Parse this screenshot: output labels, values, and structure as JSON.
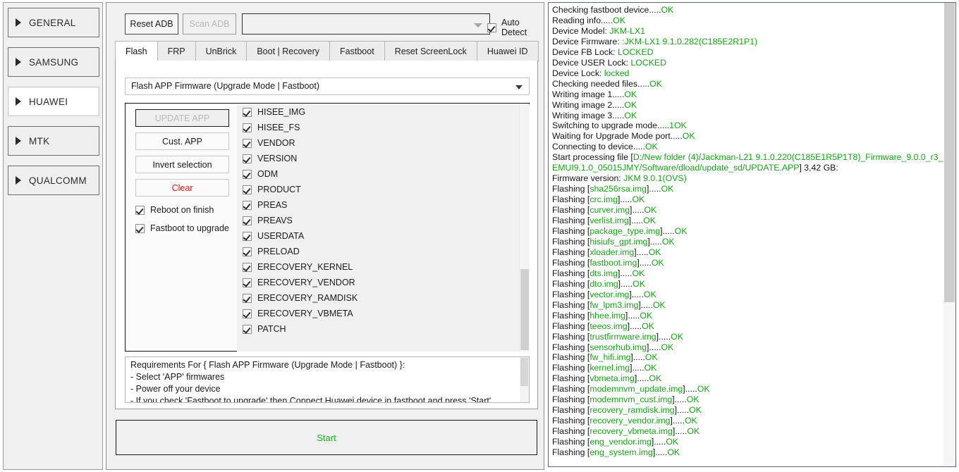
{
  "sidebar": {
    "items": [
      {
        "label": "GENERAL",
        "active": false
      },
      {
        "label": "SAMSUNG",
        "active": false
      },
      {
        "label": "HUAWEI",
        "active": true
      },
      {
        "label": "MTK",
        "active": false
      },
      {
        "label": "QUALCOMM",
        "active": false
      }
    ]
  },
  "toolbar": {
    "reset_adb_label": "Reset ADB",
    "scan_adb_label": "Scan ADB",
    "device_combo_value": "",
    "device_combo_placeholder": "",
    "auto_detect_label": "Auto Detect",
    "auto_detect_checked": true
  },
  "tabs": [
    {
      "label": "Flash",
      "active": true
    },
    {
      "label": "FRP",
      "active": false
    },
    {
      "label": "UnBrick",
      "active": false
    },
    {
      "label": "Boot | Recovery",
      "active": false
    },
    {
      "label": "Fastboot",
      "active": false
    },
    {
      "label": "Reset ScreenLock",
      "active": false
    },
    {
      "label": "Huawei ID",
      "active": false
    }
  ],
  "flash": {
    "mode_selected": "Flash APP Firmware (Upgrade Mode | Fastboot)",
    "actions": [
      {
        "label": "UPDATE APP",
        "style": "primary"
      },
      {
        "label": "Cust. APP",
        "style": "normal"
      },
      {
        "label": "Invert selection",
        "style": "normal"
      },
      {
        "label": "Clear",
        "style": "danger"
      }
    ],
    "options": [
      {
        "label": "Reboot on finish",
        "checked": true
      },
      {
        "label": "Fastboot to upgrade",
        "checked": true
      }
    ],
    "partitions": [
      {
        "label": "HISEE_IMG",
        "checked": true
      },
      {
        "label": "HISEE_FS",
        "checked": true
      },
      {
        "label": "VENDOR",
        "checked": true
      },
      {
        "label": "VERSION",
        "checked": true
      },
      {
        "label": "ODM",
        "checked": true
      },
      {
        "label": "PRODUCT",
        "checked": true
      },
      {
        "label": "PREAS",
        "checked": true
      },
      {
        "label": "PREAVS",
        "checked": true
      },
      {
        "label": "USERDATA",
        "checked": true
      },
      {
        "label": "PRELOAD",
        "checked": true
      },
      {
        "label": "ERECOVERY_KERNEL",
        "checked": true
      },
      {
        "label": "ERECOVERY_VENDOR",
        "checked": true
      },
      {
        "label": "ERECOVERY_RAMDISK",
        "checked": true
      },
      {
        "label": "ERECOVERY_VBMETA",
        "checked": true
      },
      {
        "label": "PATCH",
        "checked": true
      }
    ],
    "requirements": [
      "Requirements For { Flash APP Firmware (Upgrade Mode | Fastboot) }:",
      " - Select 'APP' firmwares",
      " - Power off your device",
      " - If you check 'Fastboot to upgrade' then Connect Huawei device in fastboot and press 'Start'"
    ],
    "start_label": "Start"
  },
  "log": {
    "lines": [
      {
        "text": "Checking fastboot device.....",
        "value": "OK"
      },
      {
        "text": "Reading info.....",
        "value": "OK"
      },
      {
        "text": "Device Model: ",
        "value": "JKM-LX1"
      },
      {
        "text": "Device Firmware: ",
        "value": ":JKM-LX1 9.1.0.282(C185E2R1P1)"
      },
      {
        "text": "Device FB Lock: ",
        "value": "LOCKED"
      },
      {
        "text": "Device USER Lock: ",
        "value": "LOCKED"
      },
      {
        "text": "Device Lock: ",
        "value": "locked"
      },
      {
        "text": "Checking needed files.....",
        "value": "OK"
      },
      {
        "text": "Writing image 1.....",
        "value": "OK"
      },
      {
        "text": "Writing image 2.....",
        "value": "OK"
      },
      {
        "text": "Writing image 3.....",
        "value": "OK"
      },
      {
        "text": "Switching to upgrade mode.....",
        "value": "1OK"
      },
      {
        "text": "Waiting for Upgrade Mode port.....",
        "value": "OK"
      },
      {
        "text": "Connecting to device.....",
        "value": "OK"
      },
      {
        "text": "Start processing file [",
        "value": "D:/New folder (4)/Jackman-L21 9.1.0.220(C185E1R5P1T8)_Firmware_9.0.0_r3_EMUI9.1.0_05015JMY/Software/dload/update_sd/UPDATE.APP",
        "suffix": "] 3,42 GB:"
      },
      {
        "text": "Firmware version: ",
        "value": "JKM 9.0.1(OVS)"
      },
      {
        "text": "Flashing [",
        "value": "sha256rsa.img",
        "suffix": "].....",
        "tail": "OK"
      },
      {
        "text": "Flashing [",
        "value": "crc.img",
        "suffix": "].....",
        "tail": "OK"
      },
      {
        "text": "Flashing [",
        "value": "curver.img",
        "suffix": "].....",
        "tail": "OK"
      },
      {
        "text": "Flashing [",
        "value": "verlist.img",
        "suffix": "].....",
        "tail": "OK"
      },
      {
        "text": "Flashing [",
        "value": "package_type.img",
        "suffix": "].....",
        "tail": "OK"
      },
      {
        "text": "Flashing [",
        "value": "hisiufs_gpt.img",
        "suffix": "].....",
        "tail": "OK"
      },
      {
        "text": "Flashing [",
        "value": "xloader.img",
        "suffix": "].....",
        "tail": "OK"
      },
      {
        "text": "Flashing [",
        "value": "fastboot.img",
        "suffix": "].....",
        "tail": "OK"
      },
      {
        "text": "Flashing [",
        "value": "dts.img",
        "suffix": "].....",
        "tail": "OK"
      },
      {
        "text": "Flashing [",
        "value": "dto.img",
        "suffix": "].....",
        "tail": "OK"
      },
      {
        "text": "Flashing [",
        "value": "vector.img",
        "suffix": "].....",
        "tail": "OK"
      },
      {
        "text": "Flashing [",
        "value": "fw_lpm3.img",
        "suffix": "].....",
        "tail": "OK"
      },
      {
        "text": "Flashing [",
        "value": "hhee.img",
        "suffix": "].....",
        "tail": "OK"
      },
      {
        "text": "Flashing [",
        "value": "teeos.img",
        "suffix": "].....",
        "tail": "OK"
      },
      {
        "text": "Flashing [",
        "value": "trustfirmware.img",
        "suffix": "].....",
        "tail": "OK"
      },
      {
        "text": "Flashing [",
        "value": "sensorhub.img",
        "suffix": "].....",
        "tail": "OK"
      },
      {
        "text": "Flashing [",
        "value": "fw_hifi.img",
        "suffix": "].....",
        "tail": "OK"
      },
      {
        "text": "Flashing [",
        "value": "kernel.img",
        "suffix": "].....",
        "tail": "OK"
      },
      {
        "text": "Flashing [",
        "value": "vbmeta.img",
        "suffix": "].....",
        "tail": "OK"
      },
      {
        "text": "Flashing [",
        "value": "modemnvm_update.img",
        "suffix": "].....",
        "tail": "OK"
      },
      {
        "text": "Flashing [",
        "value": "modemnvm_cust.img",
        "suffix": "].....",
        "tail": "OK"
      },
      {
        "text": "Flashing [",
        "value": "recovery_ramdisk.img",
        "suffix": "].....",
        "tail": "OK"
      },
      {
        "text": "Flashing [",
        "value": "recovery_vendor.img",
        "suffix": "].....",
        "tail": "OK"
      },
      {
        "text": "Flashing [",
        "value": "recovery_vbmeta.img",
        "suffix": "].....",
        "tail": "OK"
      },
      {
        "text": "Flashing [",
        "value": "eng_vendor.img",
        "suffix": "].....",
        "tail": "OK"
      },
      {
        "text": "Flashing [",
        "value": "eng_system.img",
        "suffix": "].....",
        "tail": "OK"
      }
    ]
  },
  "colors": {
    "success": "#13a513",
    "danger": "#ee1111",
    "panel": "#f0f0f0"
  }
}
